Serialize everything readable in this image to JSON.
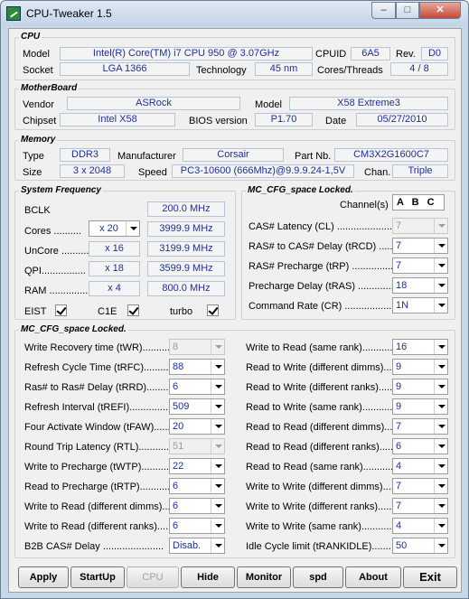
{
  "window": {
    "title": "CPU-Tweaker 1.5"
  },
  "cpu": {
    "legend": "CPU",
    "model_label": "Model",
    "model_value": "Intel(R) Core(TM) i7 CPU        950  @ 3.07GHz",
    "cpuid_label": "CPUID",
    "cpuid_value": "6A5",
    "rev_label": "Rev.",
    "rev_value": "D0",
    "socket_label": "Socket",
    "socket_value": "LGA 1366",
    "tech_label": "Technology",
    "tech_value": "45 nm",
    "cores_label": "Cores/Threads",
    "cores_value": "4 / 8"
  },
  "motherboard": {
    "legend": "MotherBoard",
    "vendor_label": "Vendor",
    "vendor_value": "ASRock",
    "model_label": "Model",
    "model_value": "X58 Extreme3",
    "chipset_label": "Chipset",
    "chipset_value": "Intel X58",
    "bios_label": "BIOS version",
    "bios_value": "P1.70",
    "date_label": "Date",
    "date_value": "05/27/2010"
  },
  "memory": {
    "legend": "Memory",
    "type_label": "Type",
    "type_value": "DDR3",
    "manu_label": "Manufacturer",
    "manu_value": "Corsair",
    "part_label": "Part Nb.",
    "part_value": "CM3X2G1600C7",
    "size_label": "Size",
    "size_value": "3 x 2048",
    "speed_label": "Speed",
    "speed_value": "PC3-10600 (666Mhz)@9.9.9.24-1,5V",
    "chan_label": "Chan.",
    "chan_value": "Triple"
  },
  "sysfreq": {
    "legend": "System Frequency",
    "bclk_label": "BCLK",
    "bclk_value": "200.0 MHz",
    "cores_label": "Cores ..........",
    "cores_mult": "x 20",
    "cores_freq": "3999.9 MHz",
    "uncore_label": "UnCore ..........",
    "uncore_mult": "x 16",
    "uncore_freq": "3199.9 MHz",
    "qpi_label": "QPI................",
    "qpi_mult": "x 18",
    "qpi_freq": "3599.9 MHz",
    "ram_label": "RAM ................",
    "ram_mult": "x 4",
    "ram_freq": "800.0 MHz",
    "eist_label": "EIST",
    "c1e_label": "C1E",
    "turbo_label": "turbo"
  },
  "mc_top": {
    "legend": "MC_CFG_space Locked.",
    "channels_label": "Channel(s)",
    "channels_value": "A B C",
    "rows": [
      {
        "label": "CAS# Latency (CL) ....................",
        "value": "7",
        "disabled": true
      },
      {
        "label": "RAS# to CAS# Delay (tRCD) .......",
        "value": "7",
        "disabled": false
      },
      {
        "label": "RAS# Precharge (tRP) ...............",
        "value": "7",
        "disabled": false
      },
      {
        "label": "Precharge Delay (tRAS) ..............",
        "value": "18",
        "disabled": false
      },
      {
        "label": "Command Rate (CR) ..................",
        "value": "1N",
        "disabled": false
      }
    ]
  },
  "mc_bottom": {
    "legend": "MC_CFG_space Locked.",
    "left": [
      {
        "label": "Write Recovery time (tWR)..........",
        "value": "8",
        "disabled": true
      },
      {
        "label": "Refresh Cycle Time (tRFC)...........",
        "value": "88",
        "disabled": false
      },
      {
        "label": "Ras# to Ras# Delay (tRRD)..........",
        "value": "6",
        "disabled": false
      },
      {
        "label": "Refresh Interval (tREFI)...............",
        "value": "509",
        "disabled": false
      },
      {
        "label": "Four Activate Window (tFAW)......",
        "value": "20",
        "disabled": false
      },
      {
        "label": "Round Trip Latency (RTL)...........",
        "value": "51",
        "disabled": true
      },
      {
        "label": "Write to Precharge (tWTP)...........",
        "value": "22",
        "disabled": false
      },
      {
        "label": "Read to Precharge (tRTP)............",
        "value": "6",
        "disabled": false
      },
      {
        "label": "Write to Read (different dimms)....",
        "value": "6",
        "disabled": false
      },
      {
        "label": "Write to Read (different ranks).....",
        "value": "6",
        "disabled": false
      },
      {
        "label": "B2B CAS# Delay ......................",
        "value": "Disab.",
        "disabled": false
      }
    ],
    "right": [
      {
        "label": "Write to Read (same rank)............",
        "value": "16",
        "disabled": false
      },
      {
        "label": "Read to Write (different dimms)....",
        "value": "9",
        "disabled": false
      },
      {
        "label": "Read to Write (different ranks).....",
        "value": "9",
        "disabled": false
      },
      {
        "label": "Read to Write (same rank)............",
        "value": "9",
        "disabled": false
      },
      {
        "label": "Read to Read (different dimms)....",
        "value": "7",
        "disabled": false
      },
      {
        "label": "Read to Read (different ranks).....",
        "value": "6",
        "disabled": false
      },
      {
        "label": "Read to Read (same rank)............",
        "value": "4",
        "disabled": false
      },
      {
        "label": "Write to Write (different dimms)....",
        "value": "7",
        "disabled": false
      },
      {
        "label": "Write to Write (different ranks).....",
        "value": "7",
        "disabled": false
      },
      {
        "label": "Write to Write (same rank)............",
        "value": "4",
        "disabled": false
      },
      {
        "label": "Idle Cycle limit (tRANKIDLE).......",
        "value": "50",
        "disabled": false
      }
    ]
  },
  "buttons": {
    "apply": "Apply",
    "startup": "StartUp",
    "cpu": "CPU",
    "hide": "Hide",
    "monitor": "Monitor",
    "spd": "spd",
    "about": "About",
    "exit": "Exit"
  }
}
